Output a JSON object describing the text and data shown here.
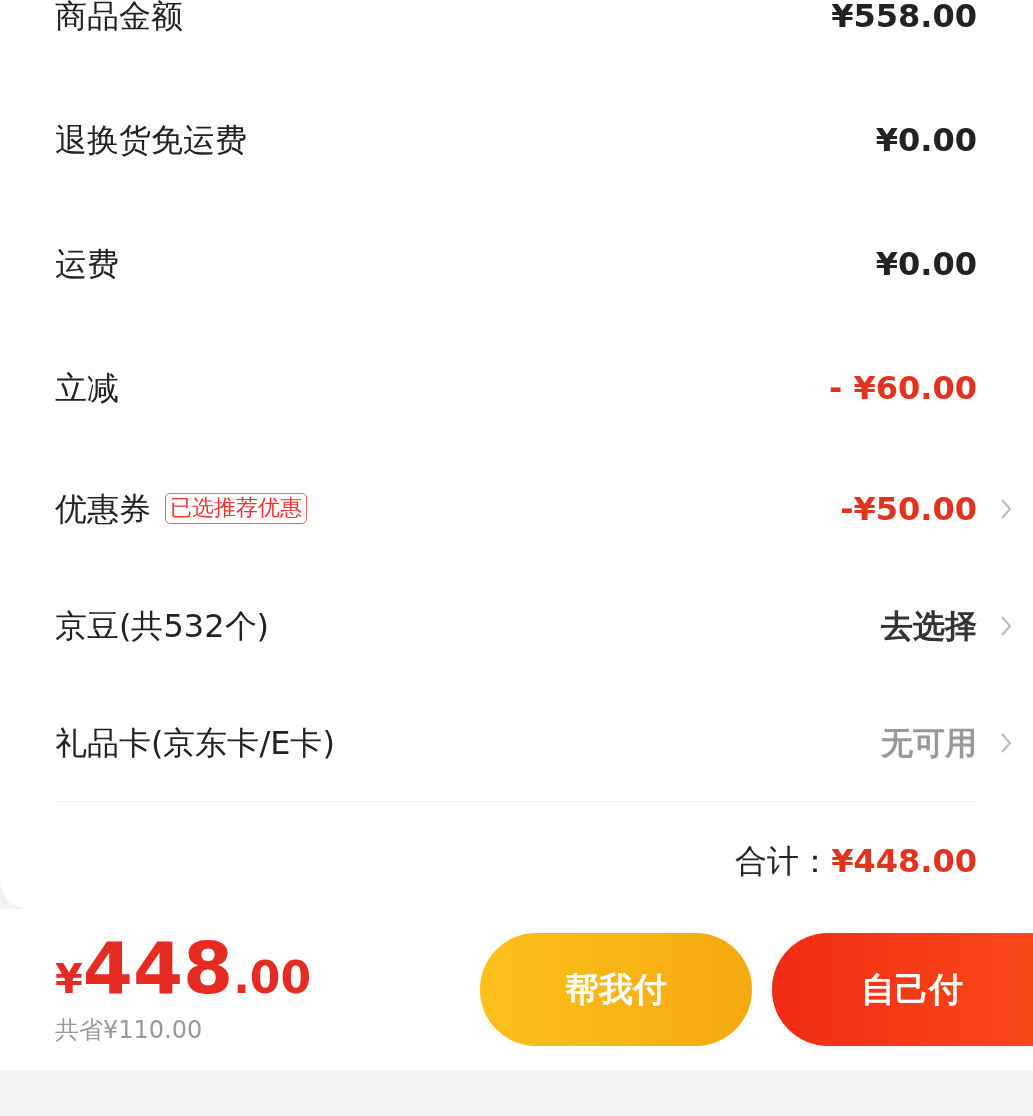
{
  "rows": [
    {
      "label": "商品金额",
      "value": "¥558.00",
      "color": "#222222",
      "chevron": false
    },
    {
      "label": "退换货免运费",
      "value": "¥0.00",
      "color": "#222222",
      "chevron": false
    },
    {
      "label": "运费",
      "value": "¥0.00",
      "color": "#222222",
      "chevron": false
    },
    {
      "label": "立减",
      "value": "- ¥60.00",
      "color": "#e2331e",
      "chevron": false
    },
    {
      "label": "优惠券",
      "tag": "已选推荐优惠",
      "value": "-¥50.00",
      "color": "#e2331e",
      "chevron": true
    },
    {
      "label": "京豆(共532个)",
      "value": "去选择",
      "color": "#333333",
      "chevron": true
    },
    {
      "label": "礼品卡(京东卡/E卡)",
      "value": "无可用",
      "color": "#999999",
      "chevron": true
    }
  ],
  "total": {
    "label": "合计：",
    "value": "¥448.00"
  },
  "footer": {
    "currency": "¥",
    "price_integer": "448",
    "price_decimal": ".00",
    "saved": "共省¥110.00",
    "buttons": [
      {
        "label": "帮我付",
        "kind": "secondary"
      },
      {
        "label": "自己付",
        "kind": "primary"
      }
    ]
  }
}
